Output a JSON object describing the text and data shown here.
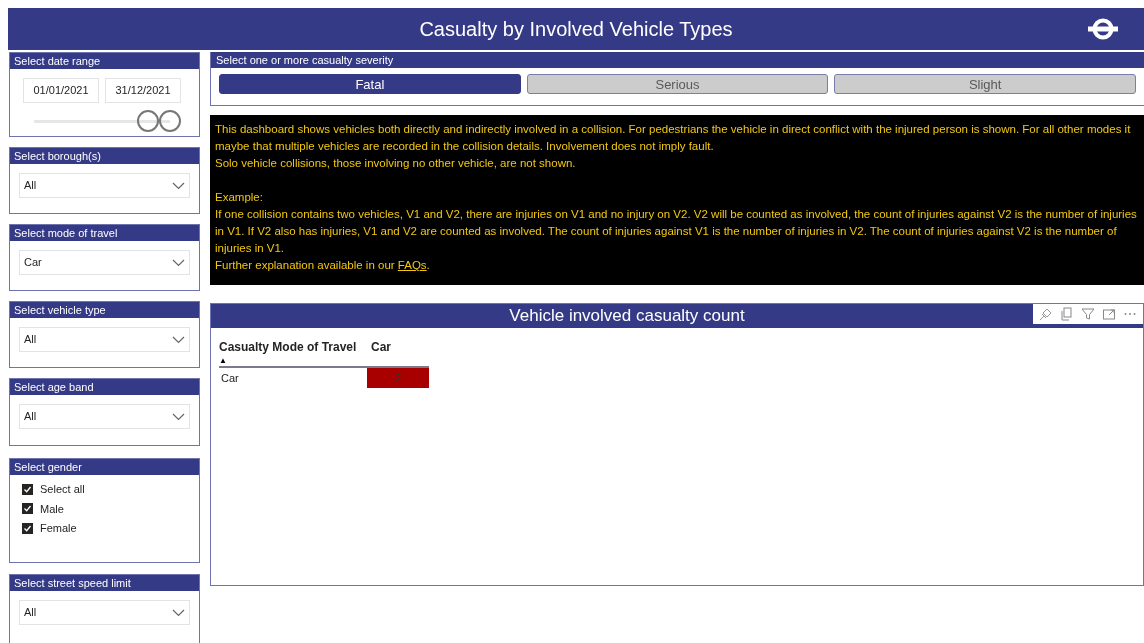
{
  "header": {
    "title": "Casualty by Involved Vehicle Types"
  },
  "slicers": [
    {
      "kind": "daterange",
      "title": "Select date range",
      "start": "01/01/2021",
      "end": "31/12/2021",
      "level": 1
    },
    {
      "kind": "dropdown",
      "title": "Select borough(s)",
      "value": "All"
    },
    {
      "kind": "dropdown",
      "title": "Select mode of travel",
      "value": "Car"
    },
    {
      "kind": "dropdown",
      "title": "Select vehicle type",
      "value": "All"
    },
    {
      "kind": "dropdown",
      "title": "Select age band",
      "value": "All"
    },
    {
      "kind": "checklist",
      "title": "Select gender",
      "options": [
        {
          "label": "Select all",
          "checked": true
        },
        {
          "label": "Male",
          "checked": true
        },
        {
          "label": "Female",
          "checked": true
        }
      ]
    },
    {
      "kind": "dropdown",
      "title": "Select street speed limit",
      "value": "All"
    }
  ],
  "severity": {
    "title": "Select one or more casualty severity",
    "options": [
      {
        "label": "Fatal",
        "selected": true
      },
      {
        "label": "Serious",
        "selected": false
      },
      {
        "label": "Slight",
        "selected": false
      }
    ]
  },
  "info": {
    "blocks": [
      [
        "This dashboard shows vehicles both directly and indirectly involved in a collision.  For pedestrians the vehicle in direct conflict with the injured person is shown. For all other modes it maybe that multiple vehicles are recorded in the collision details. Involvement does not imply fault.",
        "Solo vehicle collisions, those involving no other vehicle, are not shown."
      ],
      [
        "Example:",
        "If one collision contains two vehicles, V1 and V2, there are injuries on V1 and no injury on V2. V2 will be counted as involved, the count of injuries against V2 is the number of injuries in V1. If V2 also has injuries, V1 and V2 are counted as involved. The count of injuries against V1 is the number of injuries in V2. The count of injuries against V2 is the number of injuries in V1."
      ]
    ],
    "link_line": {
      "before": "Further explanation available in our ",
      "link": "FAQs",
      "after": "."
    }
  },
  "matrix": {
    "title": "Vehicle involved casualty count",
    "columns": [
      "Casualty Mode of Travel",
      "Car"
    ],
    "sort_indicator": "▲",
    "rows": [
      {
        "label": "Car",
        "value": "2",
        "color": "#a80000"
      }
    ]
  }
}
